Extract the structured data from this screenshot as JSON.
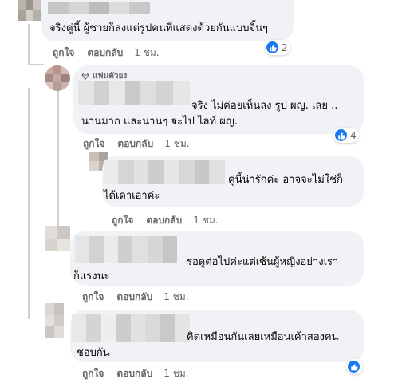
{
  "comments": [
    {
      "text": "จริงคู่นี้ ผู้ชายก็ลงแต่รูปคนที่แสดงด้วยกันแบบจิ้นๆ",
      "like_label": "ถูกใจ",
      "reply_label": "ตอบกลับ",
      "time": "1 ชม.",
      "reaction_count": "2"
    },
    {
      "badge": "แฟนตัวยง",
      "text_line1": "จริง ไม่ค่อยเห็นลง รูป ผญ. เลย ..",
      "text_line2": "นานมาก และนานๆ จะไป ไลท์ ผญ.",
      "like_label": "ถูกใจ",
      "reply_label": "ตอบกลับ",
      "time": "1 ชม.",
      "reaction_count": "4"
    },
    {
      "text_line1": "คู่นี้น่ารักค่ะ อาจจะไม่ใช่ก็",
      "text_line2": "ได้เดาเอาค่ะ",
      "like_label": "ถูกใจ",
      "reply_label": "ตอบกลับ",
      "time": "1 ชม."
    },
    {
      "text_line1": "รอดูต่อไปค่ะแต่เซ้นผู้หญิงอย่างเรา",
      "text_line2": "ก็แรงนะ",
      "like_label": "ถูกใจ",
      "reply_label": "ตอบกลับ",
      "time": "1 ชม."
    },
    {
      "text_line1": "คิดเหมือนกันเลยเหมือนเค้าสองคน",
      "text_line2": "ชอบกัน",
      "like_label": "ถูกใจ",
      "reply_label": "ตอบกลับ",
      "time": "1 ชม."
    }
  ],
  "colors": {
    "bubble": "#f0f2f5",
    "meta_text": "#65676b",
    "like_blue": "#1877f2"
  },
  "icons": {
    "reaction": "like-thumb-icon",
    "badge": "diamond-icon"
  }
}
